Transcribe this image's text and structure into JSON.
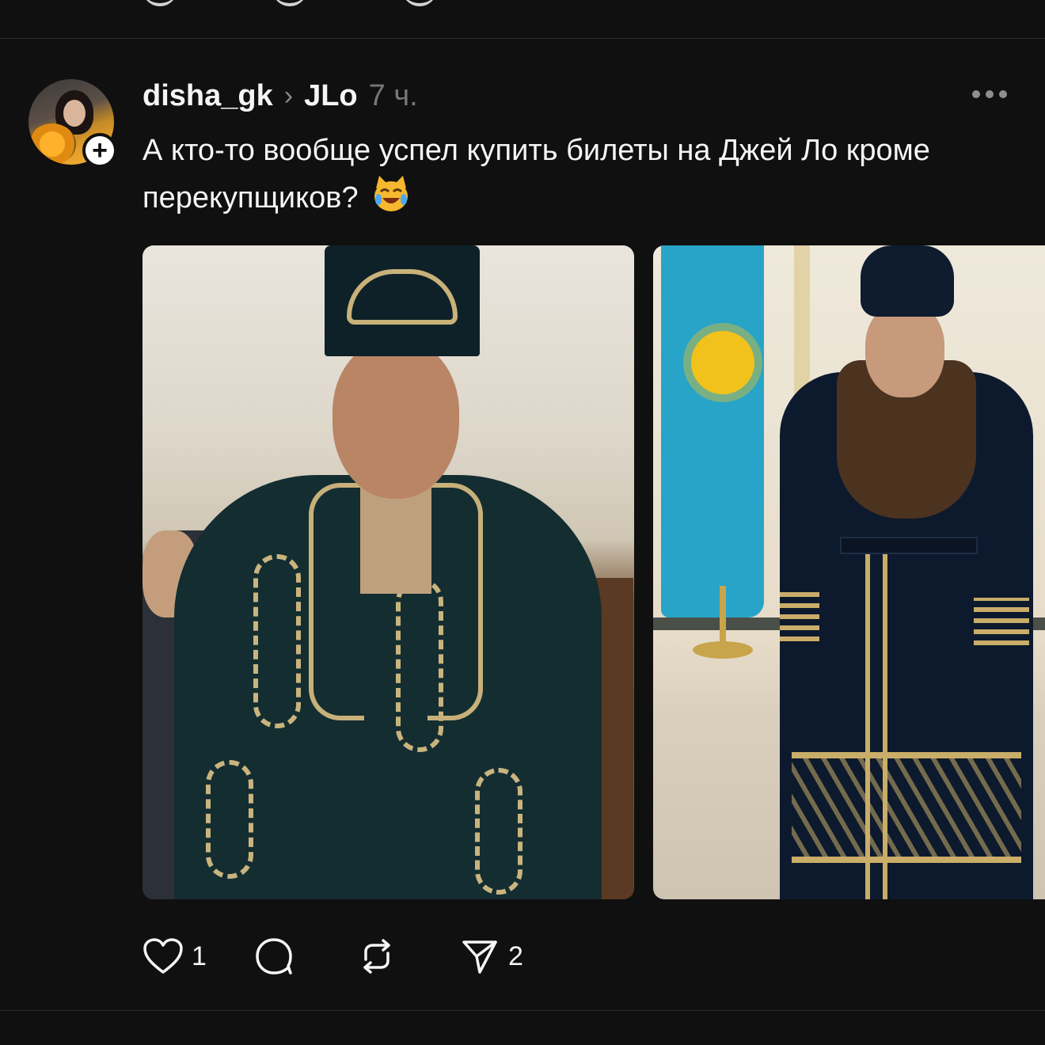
{
  "post": {
    "username": "disha_gk",
    "separator": "›",
    "community": "JLo",
    "time": "7 ч.",
    "text": "А кто-то вообще успел купить билеты на Джей Ло кроме перекупщиков?",
    "emoji": "😹"
  },
  "avatar": {
    "follow_badge": "+"
  },
  "images": [
    {
      "alt": "photo-1"
    },
    {
      "alt": "photo-2"
    }
  ],
  "actions": {
    "like_count": "1",
    "reply_count": "",
    "repost_count": "",
    "share_count": "2"
  },
  "icons": {
    "like": "heart-icon",
    "reply": "comment-icon",
    "repost": "repost-icon",
    "share": "send-icon",
    "more": "more-icon"
  },
  "colors": {
    "background": "#101010",
    "text": "#f3f5f7",
    "muted": "#777777",
    "divider": "#2d2d2d"
  }
}
